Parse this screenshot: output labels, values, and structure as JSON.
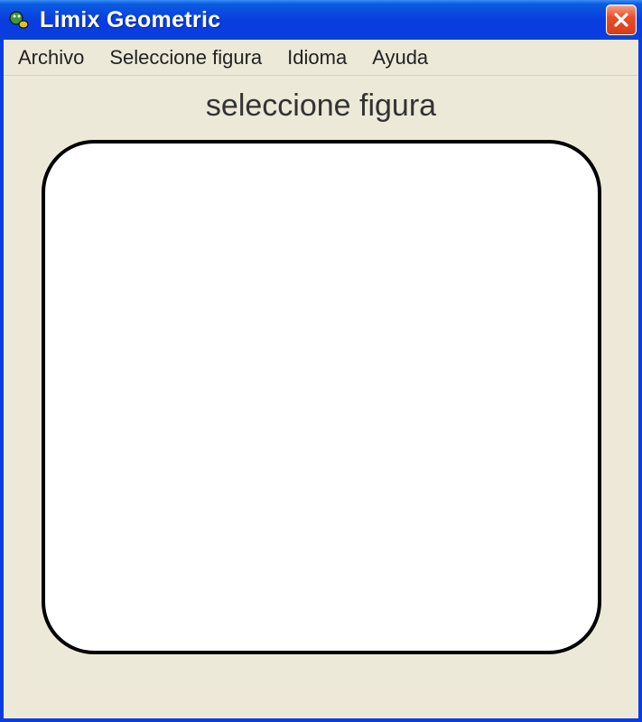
{
  "window": {
    "title": "Limix Geometric",
    "icon_name": "app-icon"
  },
  "menubar": {
    "items": [
      "Archivo",
      "Seleccione figura",
      "Idioma",
      "Ayuda"
    ]
  },
  "main": {
    "heading": "seleccione figura"
  }
}
